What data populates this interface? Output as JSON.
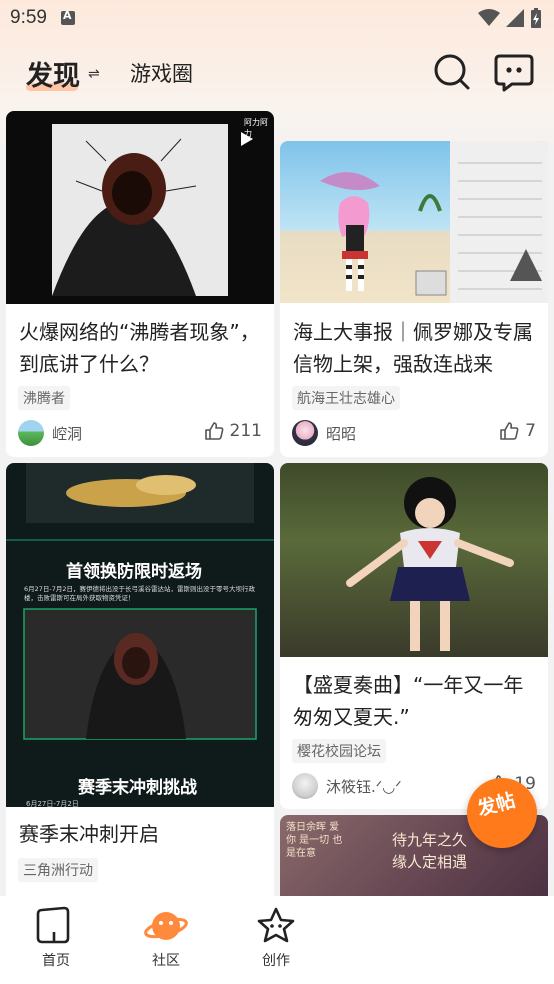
{
  "status_bar": {
    "time": "9:59"
  },
  "header": {
    "tab_discover": "发现",
    "tab_game_circle": "游戏圈"
  },
  "cards": [
    {
      "title": "火爆网络的“沸腾者现象”，到底讲了什么？",
      "tag": "沸腾者",
      "author": "崆洞",
      "likes": "211",
      "image_overlay_text": "阿力阿力",
      "media": "video"
    },
    {
      "title": "海上大事报｜佩罗娜及专属信物上架，强敌连战来",
      "tag": "航海王壮志雄心",
      "author": "昭昭",
      "likes": "7"
    },
    {
      "title": "赛季末冲刺开启",
      "tag": "三角洲行动",
      "image_texts": {
        "headline_1": "首领换防限时返场",
        "body_1": "6月27日-7月2日，赛伊德将出没于长弓溪谷雷达站，雷斯则出没于零号大坝行政楼，击败雷斯可在局外获取物资凭证！",
        "headline_2": "赛季末冲刺挑战",
        "date_snippet": "6月27日-7月2日"
      }
    },
    {
      "title": "【盛夏奏曲】“一年又一年 匆匆又夏天.”",
      "tag": "樱花校园论坛",
      "author": "沐筱钰.ᐟ◡ᐟ",
      "likes": "19"
    },
    {
      "image_texts": {
        "calligraphy": "待九年之久 缘人定相遇",
        "side_text": "落日余晖 爱你 是一切 也是在意"
      }
    }
  ],
  "fab": {
    "label": "发帖"
  },
  "bottom_nav": [
    {
      "label": "首页"
    },
    {
      "label": "社区"
    },
    {
      "label": "创作"
    }
  ],
  "colors": {
    "accent": "#ff7a1a",
    "header_gradient": "#fde9dc",
    "background": "#f2f2f2"
  },
  "icons": [
    "search-icon",
    "message-icon",
    "swap-icon",
    "like-icon",
    "play-icon",
    "home-icon",
    "planet-icon",
    "star-icon"
  ]
}
